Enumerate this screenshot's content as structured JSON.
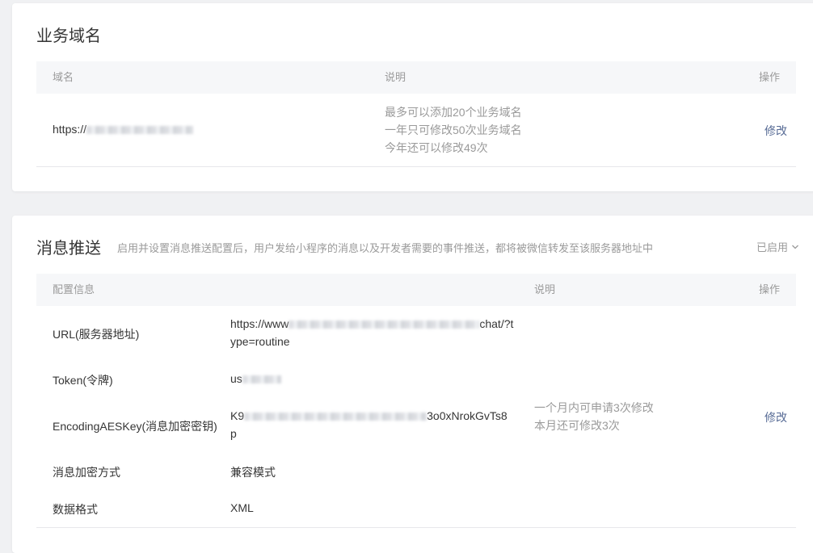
{
  "business_domain": {
    "title": "业务域名",
    "columns": {
      "domain": "域名",
      "description": "说明",
      "action": "操作"
    },
    "row": {
      "domain_prefix": "https://",
      "desc_lines": [
        "最多可以添加20个业务域名",
        "一年只可修改50次业务域名",
        "今年还可以修改49次"
      ],
      "action": "修改"
    }
  },
  "message_push": {
    "title": "消息推送",
    "description": "启用并设置消息推送配置后，用户发给小程序的消息以及开发者需要的事件推送，都将被微信转发至该服务器地址中",
    "status": "已启用",
    "columns": {
      "config": "配置信息",
      "description": "说明",
      "action": "操作"
    },
    "rows": {
      "url": {
        "label": "URL(服务器地址)",
        "value_prefix": "https://www",
        "value_suffix": "chat/?t",
        "value_line2": "ype=routine"
      },
      "token": {
        "label": "Token(令牌)",
        "value_prefix": "us"
      },
      "aeskey": {
        "label": "EncodingAESKey(消息加密密钥)",
        "value_prefix": "K9",
        "value_suffix": "3o0xNrokGvTs8",
        "value_line2": "p",
        "desc_lines": [
          "一个月内可申请3次修改",
          "本月还可修改3次"
        ],
        "action": "修改"
      },
      "encrypt_mode": {
        "label": "消息加密方式",
        "value": "兼容模式"
      },
      "data_format": {
        "label": "数据格式",
        "value": "XML"
      }
    }
  }
}
